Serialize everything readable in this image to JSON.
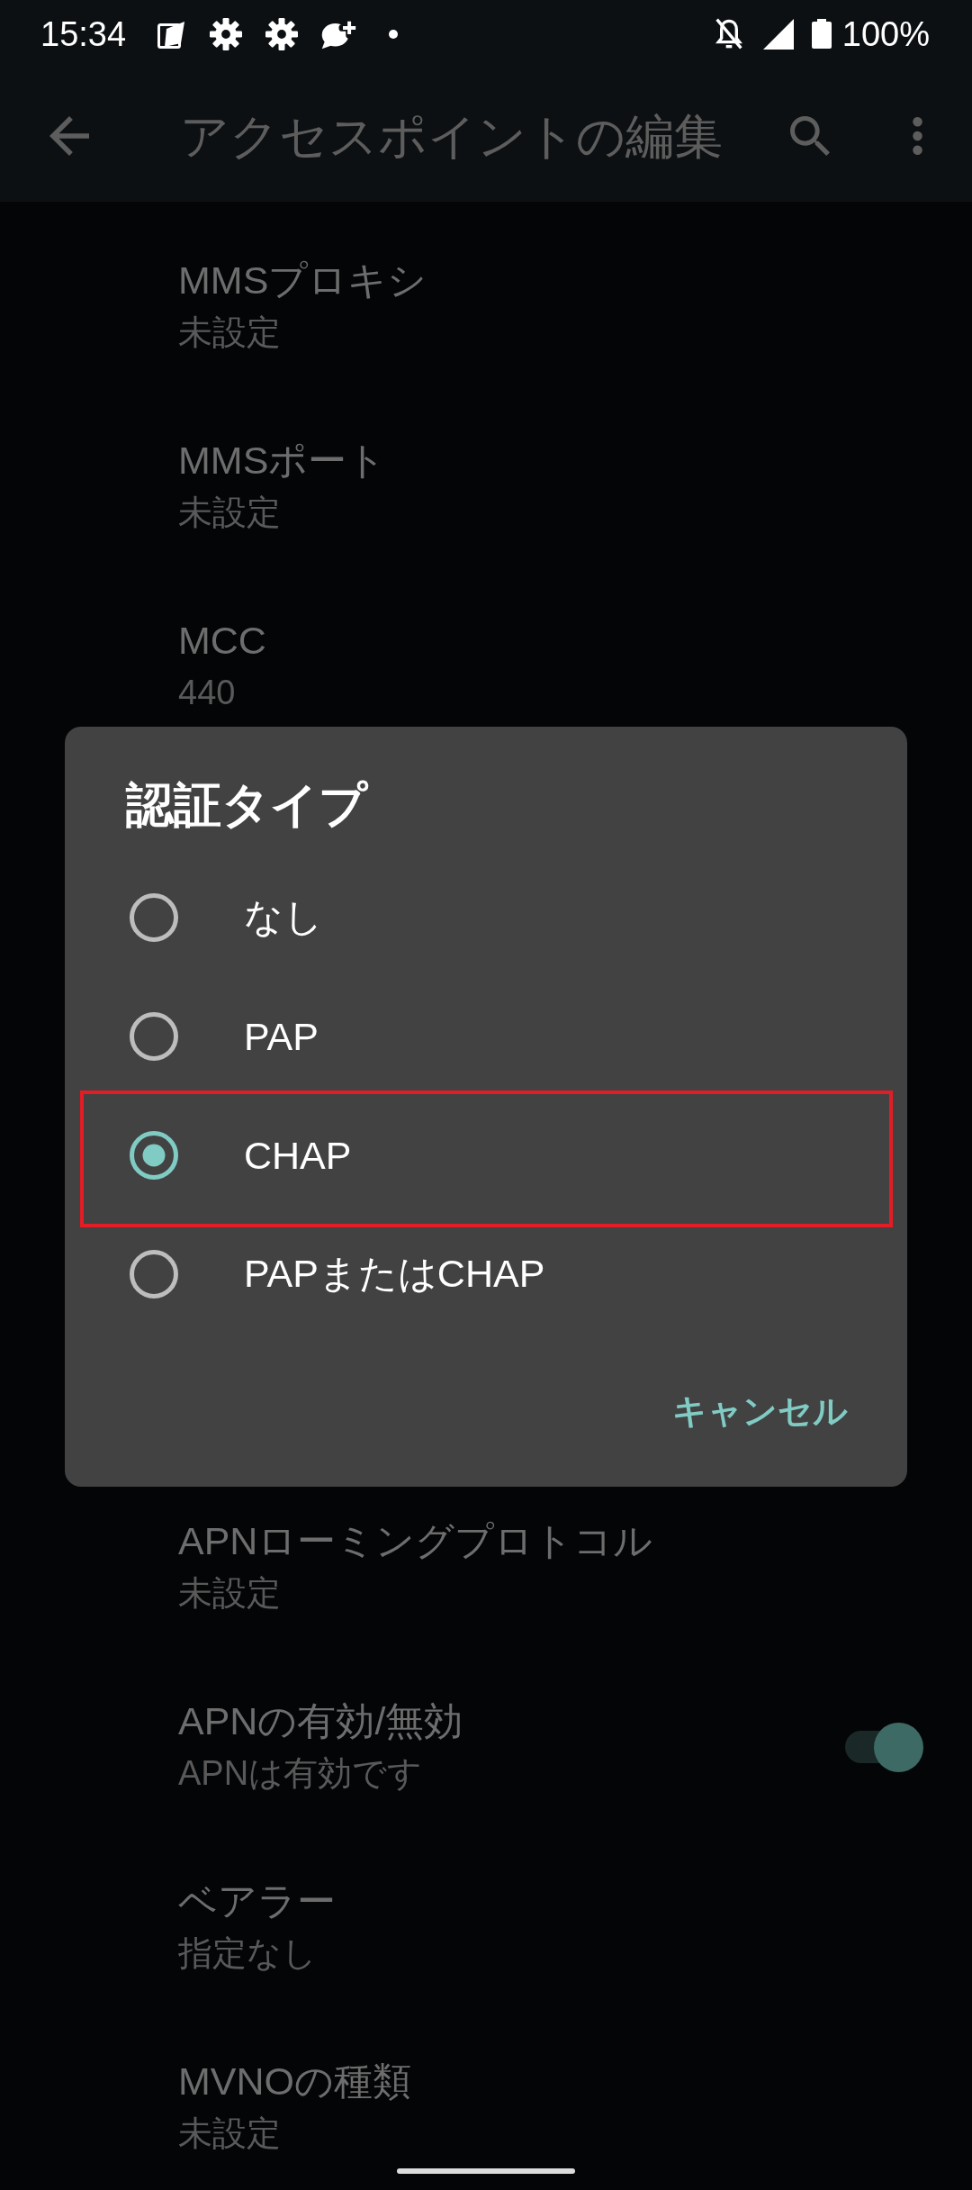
{
  "status_bar": {
    "time": "15:34",
    "battery": "100%"
  },
  "app_bar": {
    "title": "アクセスポイントの編集"
  },
  "settings_above": [
    {
      "title": "MMSプロキシ",
      "summary": "未設定"
    },
    {
      "title": "MMSポート",
      "summary": "未設定"
    },
    {
      "title": "MCC",
      "summary": "440"
    }
  ],
  "settings_below": [
    {
      "title": "APNローミングプロトコル",
      "summary": "未設定"
    },
    {
      "title": "APNの有効/無効",
      "summary": "APNは有効です",
      "switch": {
        "on": true
      }
    },
    {
      "title": "ベアラー",
      "summary": "指定なし"
    },
    {
      "title": "MVNOの種類",
      "summary": "未設定"
    }
  ],
  "dialog": {
    "title": "認証タイプ",
    "options": [
      {
        "label": "なし",
        "selected": false,
        "highlighted": false
      },
      {
        "label": "PAP",
        "selected": false,
        "highlighted": false
      },
      {
        "label": "CHAP",
        "selected": true,
        "highlighted": true
      },
      {
        "label": "PAPまたはCHAP",
        "selected": false,
        "highlighted": false
      }
    ],
    "buttons": [
      "キャンセル"
    ]
  }
}
